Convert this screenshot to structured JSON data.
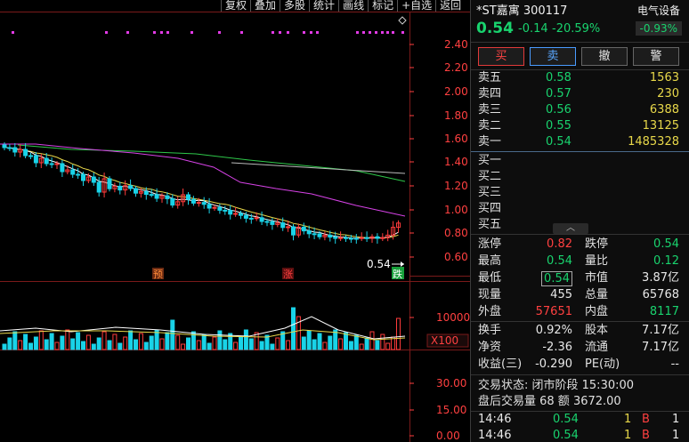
{
  "toolbar": [
    "复权",
    "叠加",
    "多股",
    "统计",
    "画线",
    "标记",
    "+自选",
    "返回"
  ],
  "chart": {
    "y_axis_labels": [
      "2.40",
      "2.20",
      "2.00",
      "1.80",
      "1.60",
      "1.40",
      "1.20",
      "1.00",
      "0.80",
      "0.60"
    ],
    "price_marker": "0.54",
    "markers": {
      "yu": "预",
      "zhang": "涨",
      "die": "跌"
    },
    "volume_label": "10000",
    "volume_unit": "X100",
    "indicator_labels": [
      "30.00",
      "15.00",
      "0.00"
    ]
  },
  "colors": {
    "up": "#ff3b3b",
    "down": "#19d3e8",
    "green": "#19d36e",
    "ma5": "#ffffff",
    "ma10": "#e8d84a",
    "ma20": "#d642e6",
    "ma60": "#2ec84a"
  },
  "stock": {
    "name_code": "*ST嘉寓 300117",
    "sector": "电气设备",
    "sector_change": "-0.93%",
    "price": "0.54",
    "change": "-0.14",
    "change_pct": "-20.59%"
  },
  "buttons": {
    "buy": "买",
    "sell": "卖",
    "cancel": "撤",
    "alert": "警"
  },
  "asks": [
    {
      "label": "卖五",
      "price": "0.58",
      "vol": "1563"
    },
    {
      "label": "卖四",
      "price": "0.57",
      "vol": "230"
    },
    {
      "label": "卖三",
      "price": "0.56",
      "vol": "6388"
    },
    {
      "label": "卖二",
      "price": "0.55",
      "vol": "13125"
    },
    {
      "label": "卖一",
      "price": "0.54",
      "vol": "1485328"
    }
  ],
  "bids": [
    {
      "label": "买一"
    },
    {
      "label": "买二"
    },
    {
      "label": "买三"
    },
    {
      "label": "买四"
    },
    {
      "label": "买五"
    }
  ],
  "stats": {
    "limit_up_label": "涨停",
    "limit_up": "0.82",
    "limit_down_label": "跌停",
    "limit_down": "0.54",
    "high_label": "最高",
    "high": "0.54",
    "vol_ratio_label": "量比",
    "vol_ratio": "0.12",
    "low_label": "最低",
    "low": "0.54",
    "mktcap_label": "市值",
    "mktcap": "3.87亿",
    "cur_vol_label": "现量",
    "cur_vol": "455",
    "total_vol_label": "总量",
    "total_vol": "65768",
    "outer_label": "外盘",
    "outer": "57651",
    "inner_label": "内盘",
    "inner": "8117",
    "turnover_label": "换手",
    "turnover": "0.92%",
    "share_cap_label": "股本",
    "share_cap": "7.17亿",
    "nav_label": "净资",
    "nav": "-2.36",
    "float_label": "流通",
    "float": "7.17亿",
    "eps_label": "收益(三)",
    "eps": "-0.290",
    "pe_label": "PE(动)",
    "pe": "--"
  },
  "trade_status": "交易状态: 闭市阶段 15:30:00",
  "after_hours": "盘后交易量 68 额 3672.00",
  "ticks": [
    {
      "time": "14:46",
      "price": "0.54",
      "vol": "1",
      "side": "B",
      "num": "1"
    },
    {
      "time": "14:46",
      "price": "0.54",
      "vol": "1",
      "side": "B",
      "num": "1"
    }
  ]
}
